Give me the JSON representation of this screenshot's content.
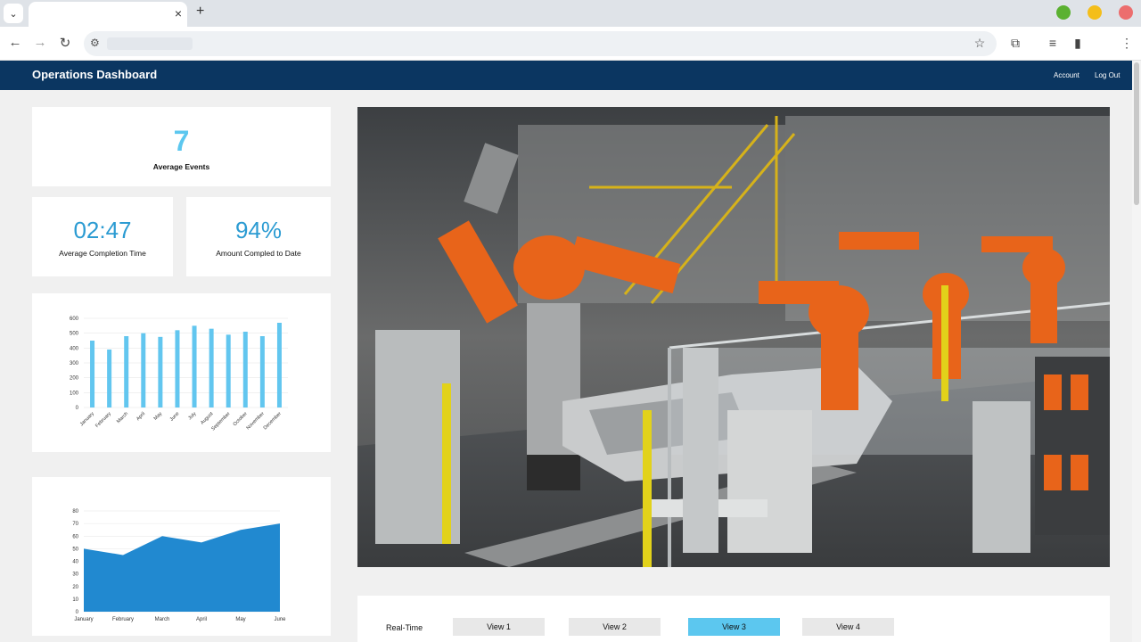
{
  "browser": {
    "tab_close": "×",
    "new_tab": "+",
    "dots": {
      "green": "#5bb131",
      "yellow": "#f4be1a",
      "red": "#ec6e6e"
    }
  },
  "header": {
    "title": "Operations Dashboard",
    "account": "Account",
    "logout": "Log Out"
  },
  "stats": {
    "average_events": {
      "value": "7",
      "label": "Average Events"
    },
    "completion_time": {
      "value": "02:47",
      "label": "Average Completion Time"
    },
    "amount_completed": {
      "value": "94%",
      "label": "Amount Compled to Date"
    }
  },
  "controls": {
    "label": "Real-Time",
    "views": [
      {
        "label": "View 1",
        "active": false
      },
      {
        "label": "View 2",
        "active": false
      },
      {
        "label": "View 3",
        "active": true
      },
      {
        "label": "View 4",
        "active": false
      }
    ]
  },
  "colors": {
    "header": "#0b3661",
    "accent": "#2b9bd2",
    "bar": "#62c6ef",
    "area": "#2189d0",
    "active_view": "#5cc7ef"
  },
  "chart_data": [
    {
      "type": "bar",
      "categories": [
        "January",
        "February",
        "March",
        "April",
        "May",
        "June",
        "July",
        "August",
        "September",
        "October",
        "November",
        "December"
      ],
      "values": [
        450,
        390,
        480,
        500,
        475,
        520,
        550,
        530,
        490,
        510,
        480,
        570
      ],
      "yticks": [
        0,
        100,
        200,
        300,
        400,
        500,
        600
      ],
      "ylim": [
        0,
        600
      ],
      "grid": true
    },
    {
      "type": "area",
      "categories": [
        "January",
        "February",
        "March",
        "April",
        "May",
        "June"
      ],
      "values": [
        50,
        45,
        60,
        55,
        65,
        70
      ],
      "yticks": [
        0,
        10,
        20,
        30,
        40,
        50,
        60,
        70,
        80
      ],
      "ylim": [
        0,
        80
      ],
      "grid": true
    }
  ]
}
